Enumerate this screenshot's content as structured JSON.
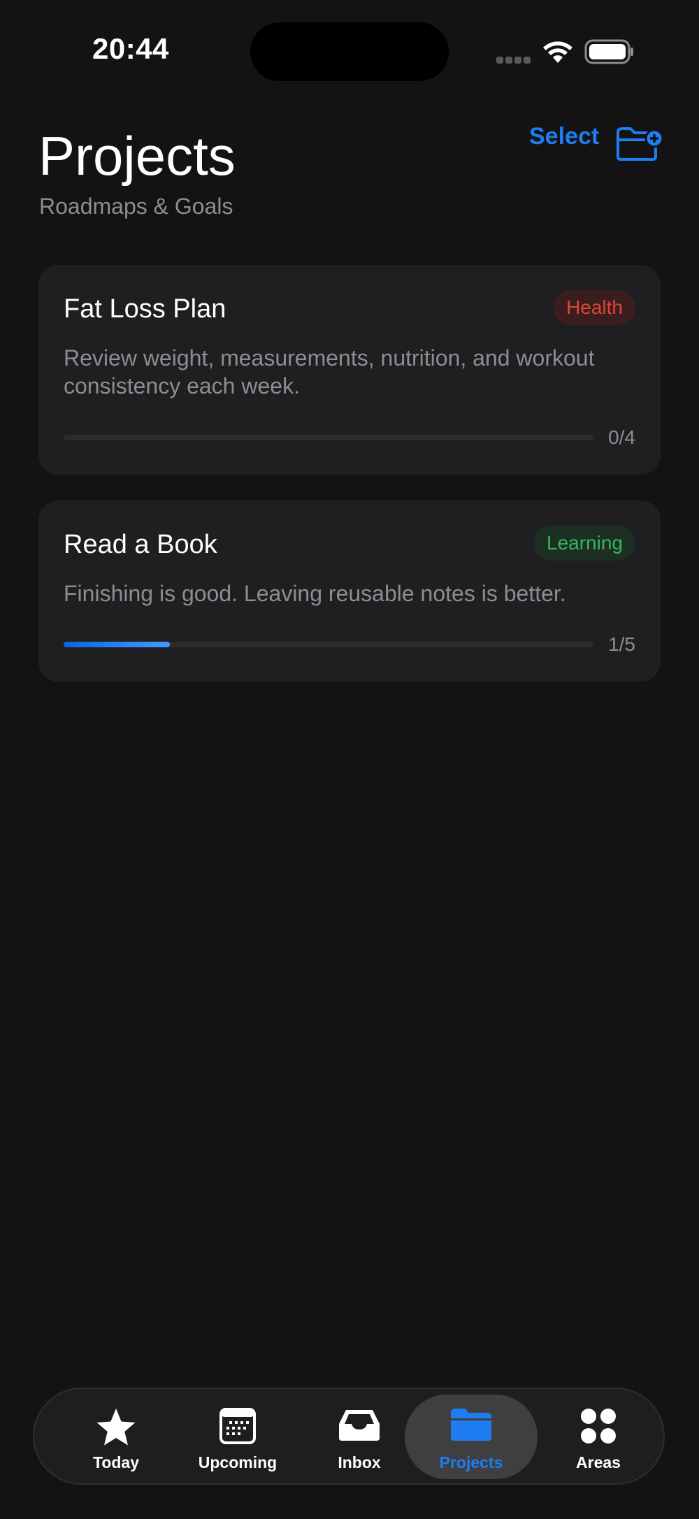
{
  "status_bar": {
    "time": "20:44"
  },
  "header": {
    "title": "Projects",
    "subtitle": "Roadmaps & Goals",
    "select_label": "Select"
  },
  "projects": [
    {
      "title": "Fat Loss Plan",
      "tag": "Health",
      "description": "Review weight, measurements, nutrition, and workout consistency each week.",
      "progress": 0.0,
      "count": "0/4"
    },
    {
      "title": "Read a Book",
      "tag": "Learning",
      "description": "Finishing is good. Leaving reusable notes is better.",
      "progress": 0.2,
      "count": "1/5"
    }
  ],
  "tab_bar": {
    "tabs": [
      {
        "label": "Today",
        "icon": "star-icon"
      },
      {
        "label": "Upcoming",
        "icon": "calendar-icon"
      },
      {
        "label": "Inbox",
        "icon": "inbox-tray-icon"
      },
      {
        "label": "Projects",
        "icon": "folder-icon",
        "active": true
      },
      {
        "label": "Areas",
        "icon": "four-circles-icon"
      }
    ]
  },
  "colors": {
    "accent": "#1e7df0",
    "health": "#e0443a",
    "learning": "#34b758",
    "background": "#131313",
    "card": "#1f1f21"
  }
}
